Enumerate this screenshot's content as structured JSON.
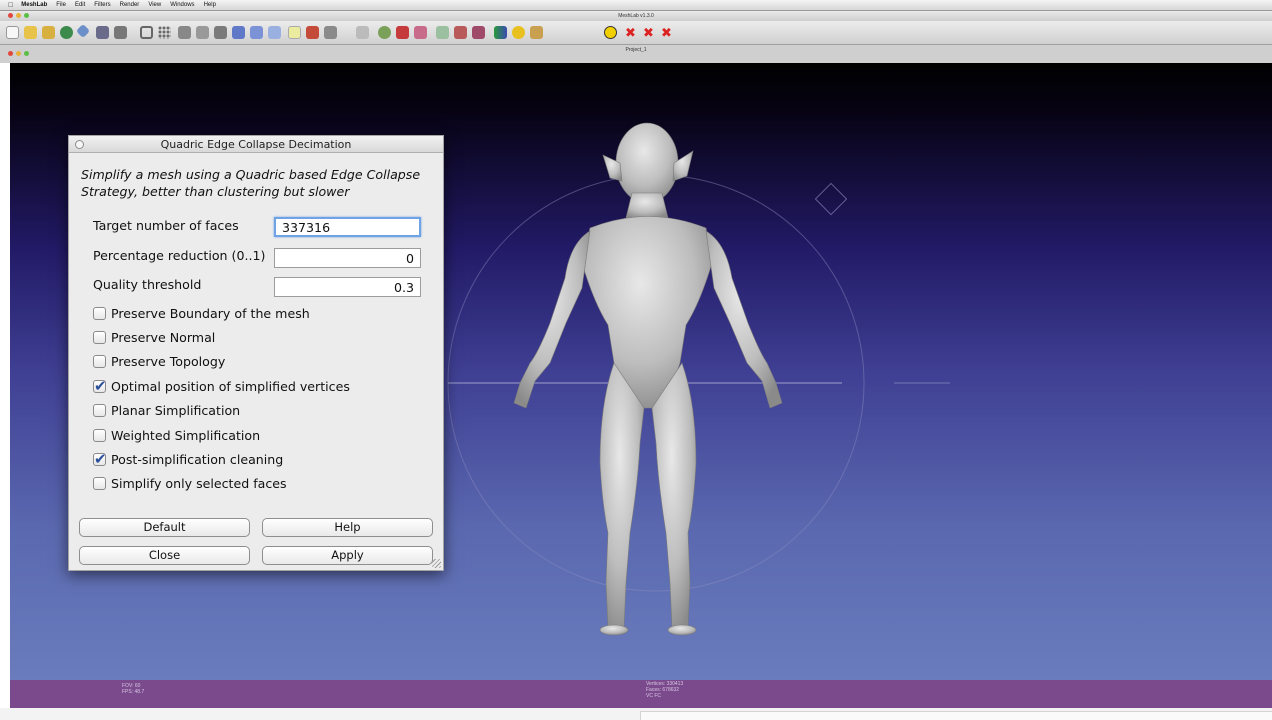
{
  "menubar": {
    "app_name": "MeshLab",
    "items": [
      "File",
      "Edit",
      "Filters",
      "Render",
      "View",
      "Windows",
      "Help"
    ]
  },
  "window": {
    "title": "MeshLab v1.3.0",
    "document_title": "Project_1"
  },
  "toolbar": {
    "icons": [
      "new-file-icon",
      "open-folder-icon",
      "open-project-icon",
      "reload-icon",
      "import-icon",
      "save-icon",
      "snapshot-icon",
      "bounding-box-icon",
      "points-icon",
      "wireframe-icon",
      "hidden-lines-icon",
      "flat-lines-icon",
      "flat-icon",
      "smooth-icon",
      "texture-icon",
      "light-icon",
      "color-icon",
      "layers-icon",
      "select-icon",
      "measure-icon",
      "paint-icon",
      "align-icon",
      "pick-points-icon",
      "select-faces-icon",
      "select-vertices-icon",
      "quality-mapper-icon",
      "annotation-icon",
      "manipulator-icon",
      "info-icon",
      "delete-faces-icon",
      "delete-vertices-icon",
      "delete-all-icon"
    ]
  },
  "dialog": {
    "title": "Quadric Edge Collapse Decimation",
    "description": "Simplify a mesh using a Quadric based Edge Collapse Strategy, better than clustering but slower",
    "params": {
      "target_faces": {
        "label": "Target number of faces",
        "value": "337316"
      },
      "percentage_reduction": {
        "label": "Percentage reduction (0..1)",
        "value": "0"
      },
      "quality_threshold": {
        "label": "Quality threshold",
        "value": "0.3"
      }
    },
    "checkboxes": [
      {
        "label": "Preserve Boundary of the mesh",
        "checked": false
      },
      {
        "label": "Preserve Normal",
        "checked": false
      },
      {
        "label": "Preserve Topology",
        "checked": false
      },
      {
        "label": "Optimal position of simplified vertices",
        "checked": true
      },
      {
        "label": "Planar Simplification",
        "checked": false
      },
      {
        "label": "Weighted Simplification",
        "checked": false
      },
      {
        "label": "Post-simplification cleaning",
        "checked": true
      },
      {
        "label": "Simplify only selected faces",
        "checked": false
      }
    ],
    "buttons": {
      "default": "Default",
      "help": "Help",
      "close": "Close",
      "apply": "Apply"
    }
  },
  "status": {
    "fov": "FOV: 60",
    "fps": "FPS:   48.7",
    "vertices": "Vertices: 330413",
    "faces": "Faces: 678632",
    "vc_fc": "VC FC"
  },
  "colors": {
    "viewport_top": "#000000",
    "viewport_bottom": "#6a7cbd",
    "status_bar": "#7b4a8d",
    "checkbox_check": "#2a4f9a",
    "input_focus": "#6fa3e6"
  }
}
